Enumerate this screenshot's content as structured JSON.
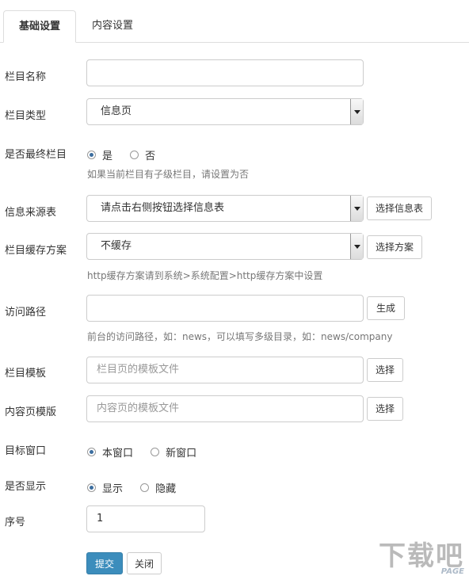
{
  "tabs": {
    "basic": "基础设置",
    "content": "内容设置"
  },
  "form": {
    "column_name": {
      "label": "栏目名称",
      "value": ""
    },
    "column_type": {
      "label": "栏目类型",
      "selected": "信息页"
    },
    "is_final": {
      "label": "是否最终栏目",
      "yes": "是",
      "no": "否",
      "help": "如果当前栏目有子级栏目，请设置为否"
    },
    "info_source": {
      "label": "信息来源表",
      "selected": "请点击右侧按钮选择信息表",
      "button": "选择信息表"
    },
    "cache_scheme": {
      "label": "栏目缓存方案",
      "selected": "不缓存",
      "button": "选择方案",
      "help": "http缓存方案请到系统>系统配置>http缓存方案中设置"
    },
    "access_path": {
      "label": "访问路径",
      "value": "",
      "button": "生成",
      "help": "前台的访问路径，如：news，可以填写多级目录，如：news/company"
    },
    "column_template": {
      "label": "栏目模板",
      "placeholder": "栏目页的模板文件",
      "button": "选择"
    },
    "content_template": {
      "label": "内容页模版",
      "placeholder": "内容页的模板文件",
      "button": "选择"
    },
    "target_window": {
      "label": "目标窗口",
      "opt1": "本窗口",
      "opt2": "新窗口"
    },
    "is_show": {
      "label": "是否显示",
      "opt1": "显示",
      "opt2": "隐藏"
    },
    "order": {
      "label": "序号",
      "value": "1"
    }
  },
  "actions": {
    "submit": "提交",
    "close": "关闭"
  },
  "watermark": {
    "main": "下载吧",
    "sub": "PAGE"
  }
}
